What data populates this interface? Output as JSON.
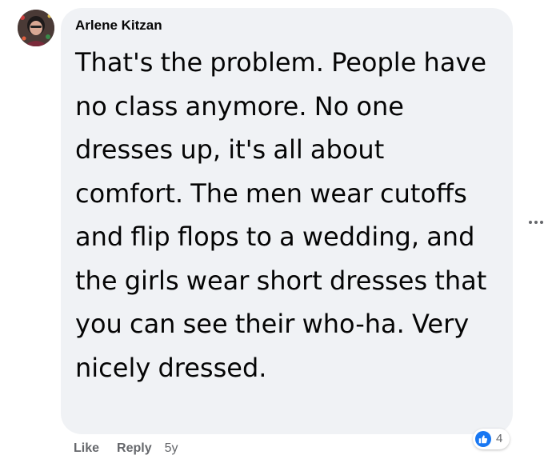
{
  "comment": {
    "author": "Arlene Kitzan",
    "text": "That's the problem. People have no class anymore. No one dresses up, it's all about comfort. The men wear cutoffs and flip flops to a wedding, and the girls wear short dresses that you can see their who-ha. Very nicely dressed."
  },
  "actions": {
    "like_label": "Like",
    "reply_label": "Reply",
    "time": "5y"
  },
  "reactions": {
    "icon": "thumbs-up-icon",
    "count": "4"
  },
  "menu": {
    "icon": "more-options-icon"
  },
  "colors": {
    "bubble": "#f0f2f5",
    "text": "#050505",
    "secondary": "#65676b",
    "like_blue": "#1877f2"
  }
}
